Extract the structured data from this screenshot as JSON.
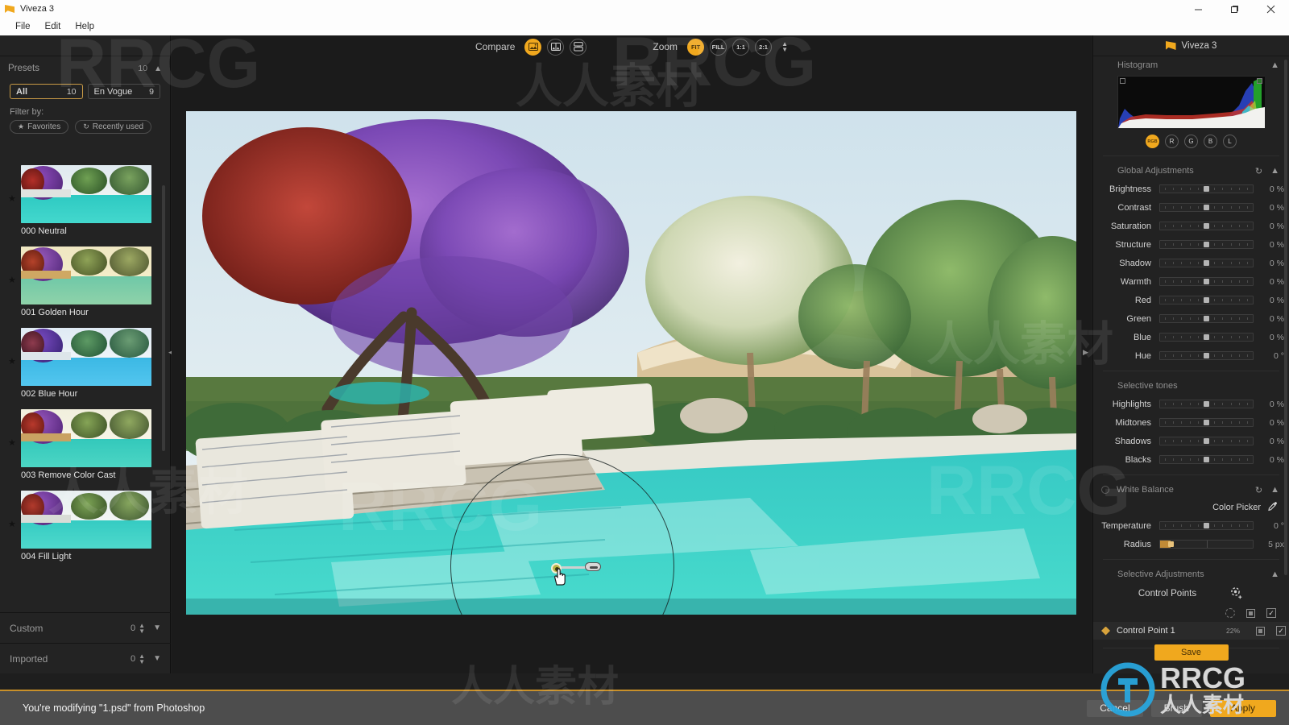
{
  "window": {
    "title": "Viveza 3",
    "app_icon": "flag-icon",
    "controls": {
      "minimize": "minimize-icon",
      "maximize": "maximize-icon",
      "close": "close-icon"
    }
  },
  "menubar": {
    "items": [
      "File",
      "Edit",
      "Help"
    ]
  },
  "left_panel": {
    "presets": {
      "title": "Presets",
      "count": "10",
      "collapse_icon": "chevron-up-icon",
      "tabs": [
        {
          "label": "All",
          "count": "10",
          "active": true
        },
        {
          "label": "En Vogue",
          "count": "9",
          "active": false
        }
      ],
      "filter_label": "Filter by:",
      "chips": [
        {
          "label": "Favorites",
          "icon": "star-icon"
        },
        {
          "label": "Recently used",
          "icon": "history-icon"
        }
      ],
      "items": [
        {
          "name": "000 Neutral",
          "favorite": true
        },
        {
          "name": "001 Golden Hour",
          "favorite": true
        },
        {
          "name": "002 Blue Hour",
          "favorite": true
        },
        {
          "name": "003 Remove Color Cast",
          "favorite": true
        },
        {
          "name": "004 Fill Light",
          "favorite": true
        }
      ]
    },
    "custom": {
      "label": "Custom",
      "count": "0",
      "chevron": "chevron-down-icon"
    },
    "imported": {
      "label": "Imported",
      "count": "0",
      "chevron": "chevron-down-icon"
    },
    "collapse_handle": "collapse-left-icon"
  },
  "toolbar": {
    "compare": {
      "label": "Compare",
      "buttons": [
        {
          "name": "single-view",
          "icon": "single-image-icon",
          "active": true
        },
        {
          "name": "split-view",
          "icon": "split-image-icon",
          "active": false
        },
        {
          "name": "side-by-side-view",
          "icon": "stacked-image-icon",
          "active": false
        }
      ]
    },
    "zoom": {
      "label": "Zoom",
      "buttons": [
        {
          "label": "FIT",
          "active": true
        },
        {
          "label": "FILL",
          "active": false
        },
        {
          "label": "1:1",
          "active": false
        },
        {
          "label": "2:1",
          "active": false
        }
      ],
      "stepper_icon": "updown-spinner-icon"
    }
  },
  "canvas": {
    "image_alt": "garden-pool-photo",
    "control_point": {
      "label": "control-point-1",
      "opacity_handle": "size-slider-handle"
    },
    "cursor": "hand-cursor",
    "collapse_handle": "collapse-right-icon"
  },
  "right_panel": {
    "header": {
      "title": "Viveza 3",
      "icon": "flag-icon"
    },
    "histogram": {
      "title": "Histogram",
      "collapse_icon": "chevron-up-icon",
      "channels": [
        {
          "label": "RGB",
          "active": true
        },
        {
          "label": "R",
          "active": false
        },
        {
          "label": "G",
          "active": false
        },
        {
          "label": "B",
          "active": false
        },
        {
          "label": "L",
          "active": false
        }
      ]
    },
    "global_adjustments": {
      "title": "Global Adjustments",
      "reset_icon": "reset-icon",
      "collapse_icon": "chevron-up-icon",
      "sliders": [
        {
          "label": "Brightness",
          "value": "0 %",
          "pos": 50
        },
        {
          "label": "Contrast",
          "value": "0 %",
          "pos": 50
        },
        {
          "label": "Saturation",
          "value": "0 %",
          "pos": 50
        },
        {
          "label": "Structure",
          "value": "0 %",
          "pos": 50
        },
        {
          "label": "Shadow",
          "value": "0 %",
          "pos": 50
        },
        {
          "label": "Warmth",
          "value": "0 %",
          "pos": 50
        },
        {
          "label": "Red",
          "value": "0 %",
          "pos": 50
        },
        {
          "label": "Green",
          "value": "0 %",
          "pos": 50
        },
        {
          "label": "Blue",
          "value": "0 %",
          "pos": 50
        },
        {
          "label": "Hue",
          "value": "0 °",
          "pos": 50
        }
      ]
    },
    "selective_tones": {
      "title": "Selective tones",
      "sliders": [
        {
          "label": "Highlights",
          "value": "0 %",
          "pos": 50
        },
        {
          "label": "Midtones",
          "value": "0 %",
          "pos": 50
        },
        {
          "label": "Shadows",
          "value": "0 %",
          "pos": 50
        },
        {
          "label": "Blacks",
          "value": "0 %",
          "pos": 50
        }
      ]
    },
    "white_balance": {
      "title": "White Balance",
      "toggle": "off",
      "reset_icon": "reset-icon",
      "collapse_icon": "chevron-up-icon",
      "color_picker": {
        "label": "Color Picker",
        "icon": "eyedropper-icon"
      },
      "temperature": {
        "label": "Temperature",
        "value": "0 °",
        "pos": 50
      },
      "radius": {
        "label": "Radius",
        "value": "5 px",
        "pos": 11
      }
    },
    "selective_adjustments": {
      "title": "Selective Adjustments",
      "collapse_icon": "chevron-up-icon",
      "control_points_label": "Control Points",
      "add_icon": "add-control-point-icon",
      "column_icons": [
        "dashed-circle-icon",
        "square-icon",
        "checkbox-icon"
      ],
      "rows": [
        {
          "name": "Control Point 1",
          "percent": "22%",
          "icon": "control-point-icon",
          "group_icon": "square-icon",
          "visible_icon": "checkbox-icon"
        }
      ],
      "save_button": "Save"
    }
  },
  "status_bar": {
    "message": "You're modifying \"1.psd\" from Photoshop",
    "buttons": [
      {
        "label": "Cancel",
        "kind": "secondary"
      },
      {
        "label": "Brush",
        "kind": "secondary"
      },
      {
        "label": "Apply",
        "kind": "primary"
      }
    ]
  },
  "watermarks": {
    "latin": "RRCG",
    "cjk": "人人素材"
  }
}
